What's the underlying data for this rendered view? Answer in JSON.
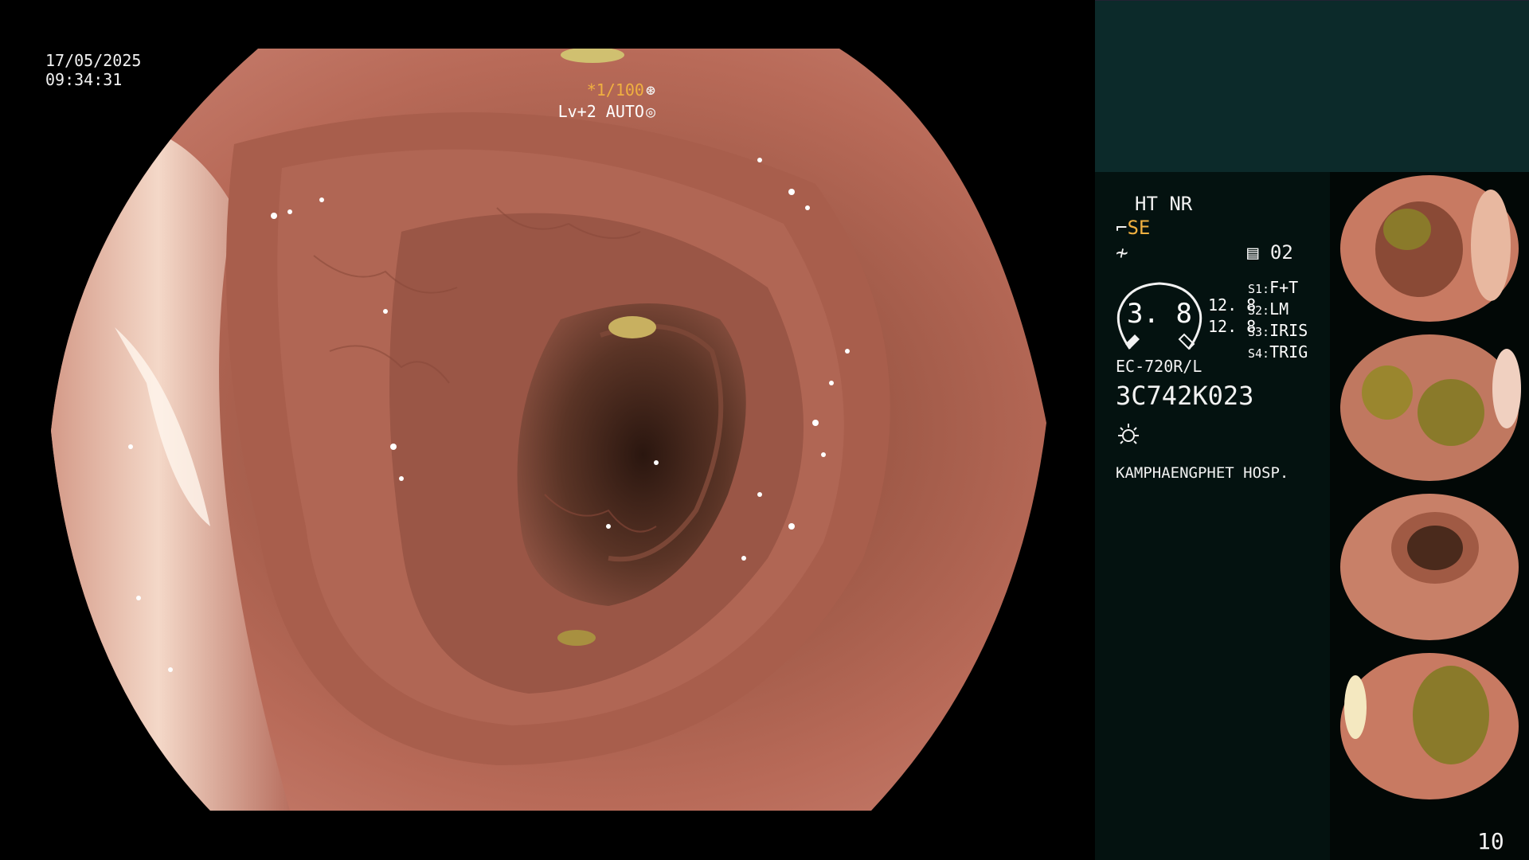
{
  "overlay": {
    "date": "17/05/2025",
    "time": "09:34:31",
    "zoom_ratio": "*1/100",
    "zoom_level": "Lv+2 AUTO"
  },
  "panel": {
    "mode_line1": "HT NR",
    "mode_se": "SE",
    "folder": "02",
    "gauge_value": "3. 8",
    "gauge_num_1": "12. 8",
    "gauge_num_2": "12. 8",
    "switches": [
      {
        "key": "S1:",
        "value": "F+T"
      },
      {
        "key": "S2:",
        "value": "LM"
      },
      {
        "key": "S3:",
        "value": "IRIS"
      },
      {
        "key": "S4:",
        "value": "TRIG"
      }
    ],
    "model": "EC-720R/L",
    "serial": "3C742K023",
    "hospital": "KAMPHAENGPHET HOSP."
  },
  "page_number": "10",
  "colors": {
    "mucosa": "#b86a58",
    "lumen_dark": "#3a2018",
    "stool": "#8a7a2a",
    "panel_teal": "#0c2a2a",
    "accent_orange": "#f0b040"
  }
}
